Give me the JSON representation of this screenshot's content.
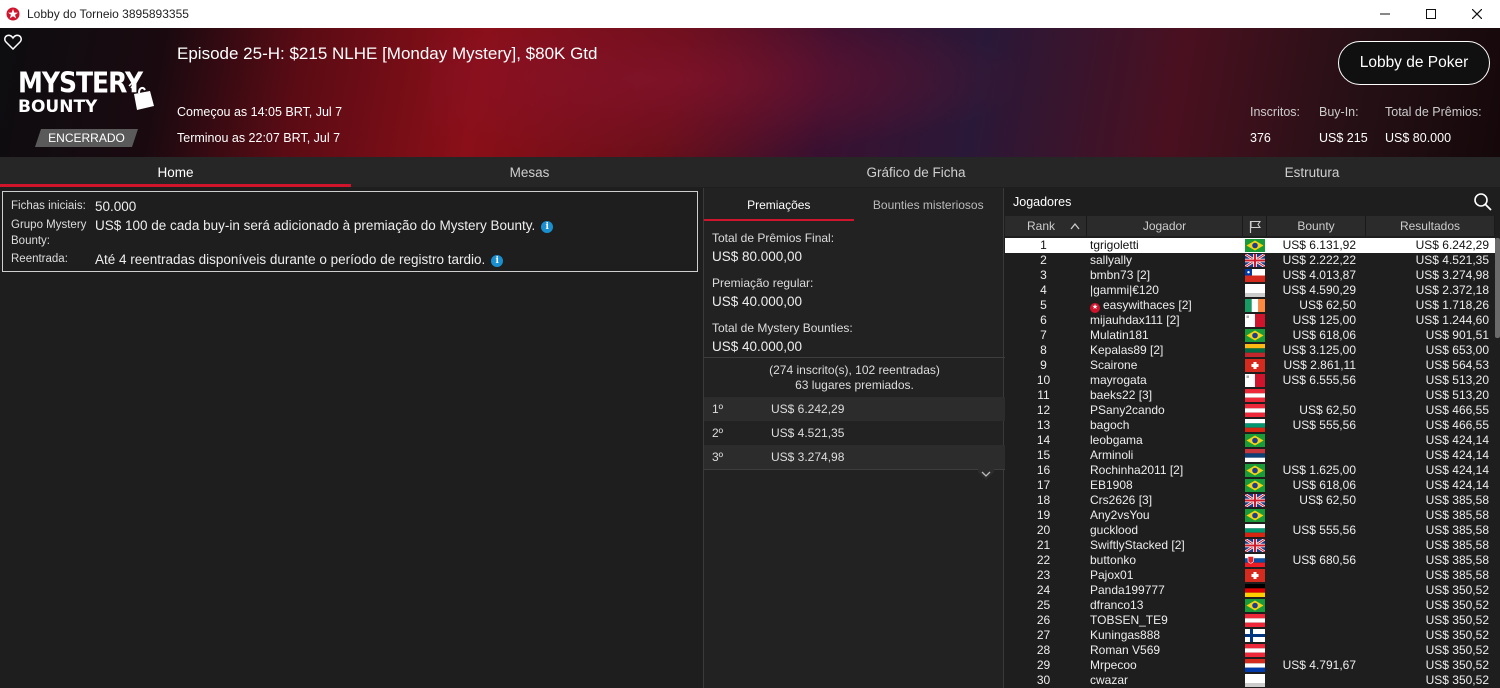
{
  "window": {
    "title": "Lobby do Torneio 3895893355"
  },
  "header": {
    "logo_line1": "MYSTERY",
    "logo_line2": "BOUNTY",
    "status_badge": "ENCERRADO",
    "title": "Episode 25-H: $215 NLHE [Monday Mystery], $80K Gtd",
    "started": "Começou as 14:05 BRT, Jul 7",
    "ended": "Terminou as 22:07 BRT, Jul 7",
    "lobby_button": "Lobby de Poker",
    "stats": {
      "entrants_label": "Inscritos:",
      "entrants_value": "376",
      "buyin_label": "Buy-In:",
      "buyin_value": "US$ 215",
      "prize_label": "Total de Prêmios:",
      "prize_value": "US$ 80.000"
    }
  },
  "tabs": [
    "Home",
    "Mesas",
    "Gráfico de Ficha",
    "Estrutura"
  ],
  "info": {
    "starting_chips_label": "Fichas iniciais:",
    "starting_chips_value": "50.000",
    "mystery_label_1": "Grupo Mystery",
    "mystery_label_2": "Bounty:",
    "mystery_value": "US$ 100 de cada buy-in será adicionado à premiação do Mystery Bounty.",
    "reentry_label": "Reentrada:",
    "reentry_value": "Até 4 reentradas disponíveis durante o período de registro tardio."
  },
  "prizes": {
    "subtabs": [
      "Premiações",
      "Bounties misteriosos"
    ],
    "final_label": "Total de Prêmios Final:",
    "final_value": "US$ 80.000,00",
    "regular_label": "Premiação regular:",
    "regular_value": "US$ 40.000,00",
    "mystery_label": "Total de Mystery Bounties:",
    "mystery_value": "US$ 40.000,00",
    "registration": "(274 inscrito(s), 102 reentradas)",
    "places_paid": "63 lugares premiados.",
    "payouts": [
      {
        "place": "1º",
        "amount": "US$ 6.242,29"
      },
      {
        "place": "2º",
        "amount": "US$ 4.521,35"
      },
      {
        "place": "3º",
        "amount": "US$ 3.274,98"
      }
    ]
  },
  "players": {
    "title": "Jogadores",
    "columns": {
      "rank": "Rank",
      "player": "Jogador",
      "bounty": "Bounty",
      "results": "Resultados"
    },
    "rows": [
      {
        "rank": "1",
        "name": "tgrigoletti",
        "flag": "br",
        "bounty": "US$ 6.131,92",
        "result": "US$ 6.242,29"
      },
      {
        "rank": "2",
        "name": "sallyally",
        "flag": "gb",
        "bounty": "US$ 2.222,22",
        "result": "US$ 4.521,35"
      },
      {
        "rank": "3",
        "name": "bmbn73 [2]",
        "flag": "cl",
        "bounty": "US$ 4.013,87",
        "result": "US$ 3.274,98"
      },
      {
        "rank": "4",
        "name": "|gammi|€120",
        "flag": "unk",
        "bounty": "US$ 4.590,29",
        "result": "US$ 2.372,18"
      },
      {
        "rank": "5",
        "name": "easywithaces [2]",
        "flag": "ie",
        "bounty": "US$ 62,50",
        "result": "US$ 1.718,26",
        "star": true
      },
      {
        "rank": "6",
        "name": "mijauhdax111 [2]",
        "flag": "mt",
        "bounty": "US$ 125,00",
        "result": "US$ 1.244,60"
      },
      {
        "rank": "7",
        "name": "Mulatin181",
        "flag": "br",
        "bounty": "US$ 618,06",
        "result": "US$ 901,51"
      },
      {
        "rank": "8",
        "name": "Kepalas89 [2]",
        "flag": "lt",
        "bounty": "US$ 3.125,00",
        "result": "US$ 653,00"
      },
      {
        "rank": "9",
        "name": "Scairone",
        "flag": "ch",
        "bounty": "US$ 2.861,11",
        "result": "US$ 564,53"
      },
      {
        "rank": "10",
        "name": "mayrogata",
        "flag": "mt",
        "bounty": "US$ 6.555,56",
        "result": "US$ 513,20"
      },
      {
        "rank": "11",
        "name": "baeks22 [3]",
        "flag": "at",
        "bounty": "",
        "result": "US$ 513,20"
      },
      {
        "rank": "12",
        "name": "PSany2cando",
        "flag": "at",
        "bounty": "US$ 62,50",
        "result": "US$ 466,55"
      },
      {
        "rank": "13",
        "name": "bagoch",
        "flag": "bg",
        "bounty": "US$ 555,56",
        "result": "US$ 466,55"
      },
      {
        "rank": "14",
        "name": "leobgama",
        "flag": "br",
        "bounty": "",
        "result": "US$ 424,14"
      },
      {
        "rank": "15",
        "name": "Arminoli",
        "flag": "rs",
        "bounty": "",
        "result": "US$ 424,14"
      },
      {
        "rank": "16",
        "name": "Rochinha2011 [2]",
        "flag": "br",
        "bounty": "US$ 1.625,00",
        "result": "US$ 424,14"
      },
      {
        "rank": "17",
        "name": "EB1908",
        "flag": "br",
        "bounty": "US$ 618,06",
        "result": "US$ 424,14"
      },
      {
        "rank": "18",
        "name": "Crs2626 [3]",
        "flag": "gb",
        "bounty": "US$ 62,50",
        "result": "US$ 385,58"
      },
      {
        "rank": "19",
        "name": "Any2vsYou",
        "flag": "br",
        "bounty": "",
        "result": "US$ 385,58"
      },
      {
        "rank": "20",
        "name": "gucklood",
        "flag": "bg",
        "bounty": "US$ 555,56",
        "result": "US$ 385,58"
      },
      {
        "rank": "21",
        "name": "SwiftlyStacked [2]",
        "flag": "gb",
        "bounty": "",
        "result": "US$ 385,58"
      },
      {
        "rank": "22",
        "name": "buttonko",
        "flag": "sk",
        "bounty": "US$ 680,56",
        "result": "US$ 385,58"
      },
      {
        "rank": "23",
        "name": "Pajox01",
        "flag": "ch",
        "bounty": "",
        "result": "US$ 385,58"
      },
      {
        "rank": "24",
        "name": "Panda199777",
        "flag": "de",
        "bounty": "",
        "result": "US$ 350,52"
      },
      {
        "rank": "25",
        "name": "dfranco13",
        "flag": "br",
        "bounty": "",
        "result": "US$ 350,52"
      },
      {
        "rank": "26",
        "name": "TOBSEN_TE9",
        "flag": "at",
        "bounty": "",
        "result": "US$ 350,52"
      },
      {
        "rank": "27",
        "name": "Kuningas888",
        "flag": "fi",
        "bounty": "",
        "result": "US$ 350,52"
      },
      {
        "rank": "28",
        "name": "Roman V569",
        "flag": "at",
        "bounty": "",
        "result": "US$ 350,52"
      },
      {
        "rank": "29",
        "name": "Mrpecoo",
        "flag": "py",
        "bounty": "US$ 4.791,67",
        "result": "US$ 350,52"
      },
      {
        "rank": "30",
        "name": "cwazar",
        "flag": "unk",
        "bounty": "",
        "result": "US$ 350,52"
      }
    ]
  },
  "colors": {
    "accent": "#d0142c",
    "info_icon": "#1a8fd0"
  }
}
